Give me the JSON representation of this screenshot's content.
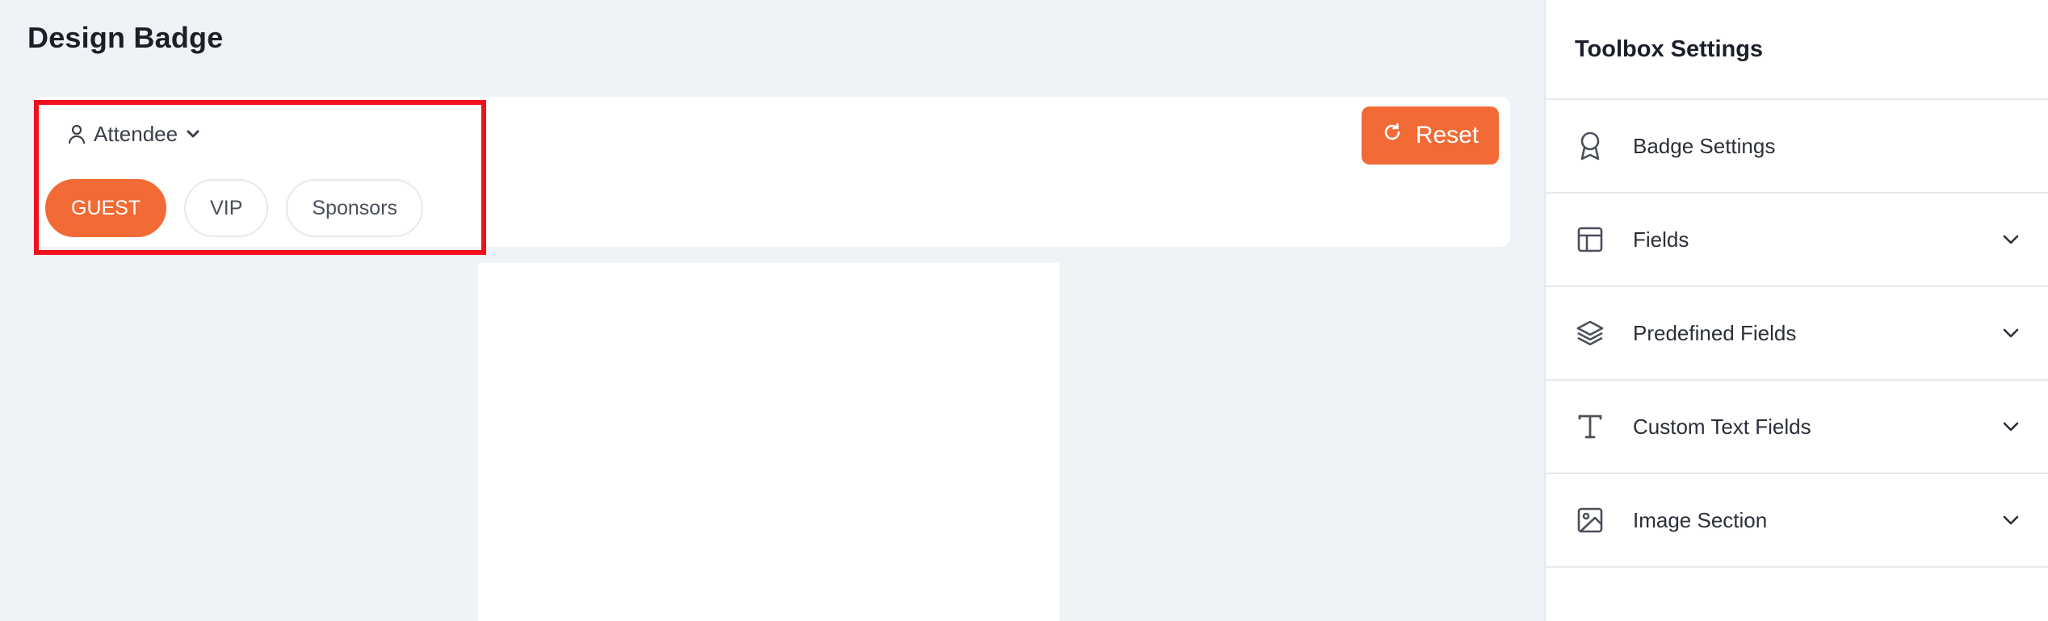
{
  "page": {
    "title": "Design Badge"
  },
  "badge_type": {
    "selected": "Attendee",
    "icon": "user-icon"
  },
  "categories": [
    {
      "label": "GUEST",
      "active": true
    },
    {
      "label": "VIP",
      "active": false
    },
    {
      "label": "Sponsors",
      "active": false
    }
  ],
  "reset": {
    "label": "Reset",
    "icon": "refresh-icon"
  },
  "toolbox": {
    "title": "Toolbox Settings",
    "sections": [
      {
        "label": "Badge Settings",
        "icon": "award-icon",
        "expandable": false
      },
      {
        "label": "Fields",
        "icon": "layout-icon",
        "expandable": true
      },
      {
        "label": "Predefined Fields",
        "icon": "layers-icon",
        "expandable": true
      },
      {
        "label": "Custom Text Fields",
        "icon": "text-icon",
        "expandable": true
      },
      {
        "label": "Image Section",
        "icon": "image-icon",
        "expandable": true
      }
    ]
  },
  "colors": {
    "accent": "#f26a35",
    "highlight_border": "#f0101c",
    "background": "#eff2f7"
  }
}
